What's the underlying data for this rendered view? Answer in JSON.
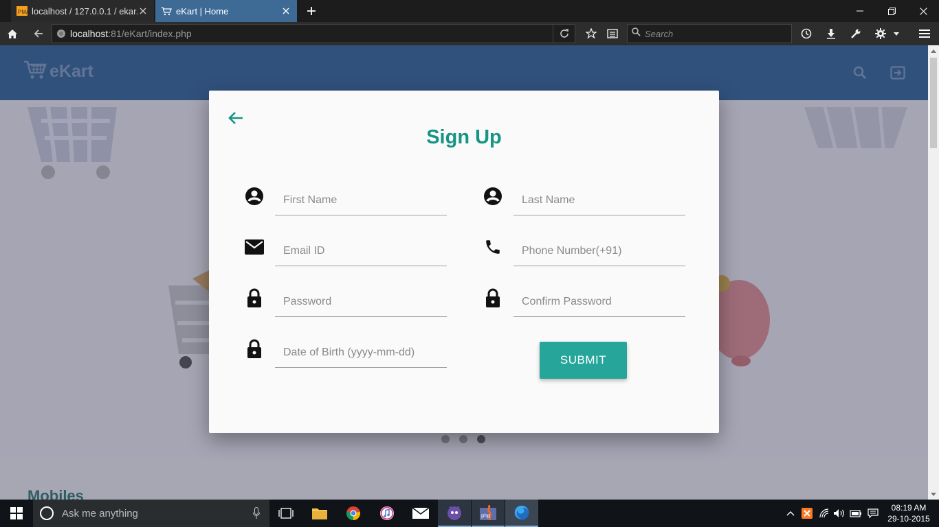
{
  "browser": {
    "tabs": [
      {
        "title": "localhost / 127.0.0.1 / ekar..."
      },
      {
        "title": "eKart | Home"
      }
    ],
    "url_host": "localhost",
    "url_rest": ":81/eKart/index.php",
    "search_placeholder": "Search"
  },
  "site": {
    "logo_text": "eKart",
    "section_title": "Mobiles",
    "carousel_count": 3,
    "carousel_active": 3
  },
  "modal": {
    "title": "Sign Up",
    "fields": {
      "first_name": "First Name",
      "last_name": "Last Name",
      "email": "Email ID",
      "phone": "Phone Number(+91)",
      "password": "Password",
      "confirm_password": "Confirm Password",
      "dob": "Date of Birth (yyyy-mm-dd)"
    },
    "submit_label": "SUBMIT"
  },
  "taskbar": {
    "search_placeholder": "Ask me anything",
    "time": "08:19 AM",
    "date": "29-10-2015"
  },
  "colors": {
    "header": "#1e5a91",
    "accent": "#26a69a",
    "title": "#169485"
  }
}
